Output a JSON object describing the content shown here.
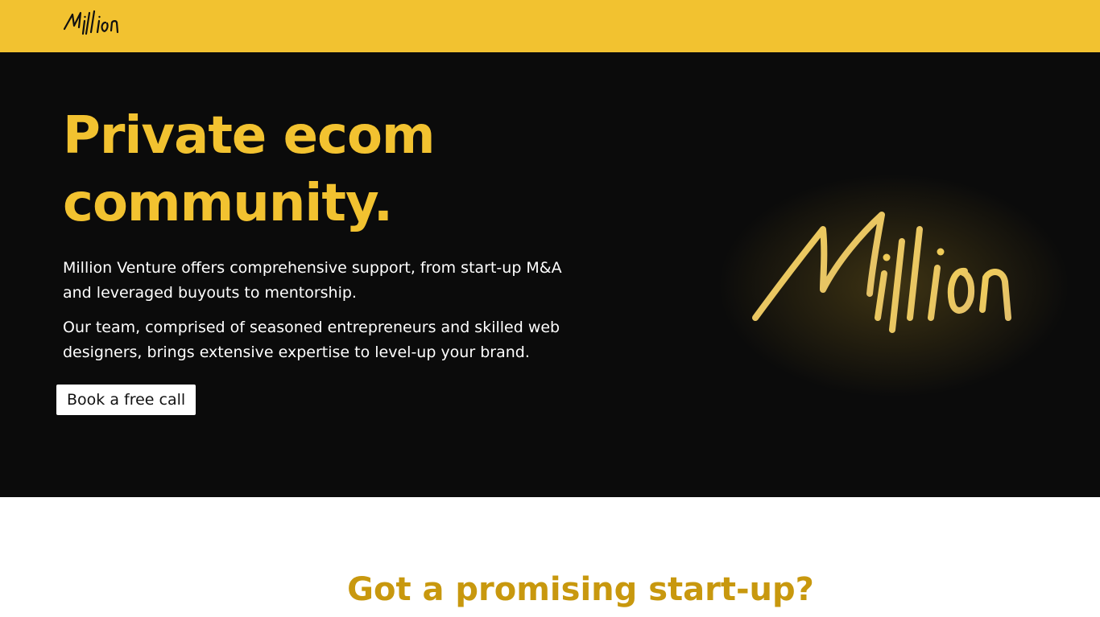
{
  "colors": {
    "brand_yellow": "#f2c230",
    "hero_background": "#0b0b0b",
    "section_title_gold": "#c8980e",
    "cta_background": "#ffffff"
  },
  "header": {
    "logo_icon": "million-script-logo-icon"
  },
  "hero": {
    "title_line_1": "Private ecom",
    "title_line_2": "community.",
    "paragraph_1": "Million Venture offers comprehensive support, from start-up M&A and leveraged buyouts to mentorship.",
    "paragraph_2": "Our team, comprised of seasoned entrepreneurs and skilled web designers, brings extensive expertise to level-up your brand.",
    "cta_label": "Book a free call",
    "logo_icon": "million-script-logo-icon"
  },
  "section": {
    "title": "Got a promising start-up?"
  }
}
